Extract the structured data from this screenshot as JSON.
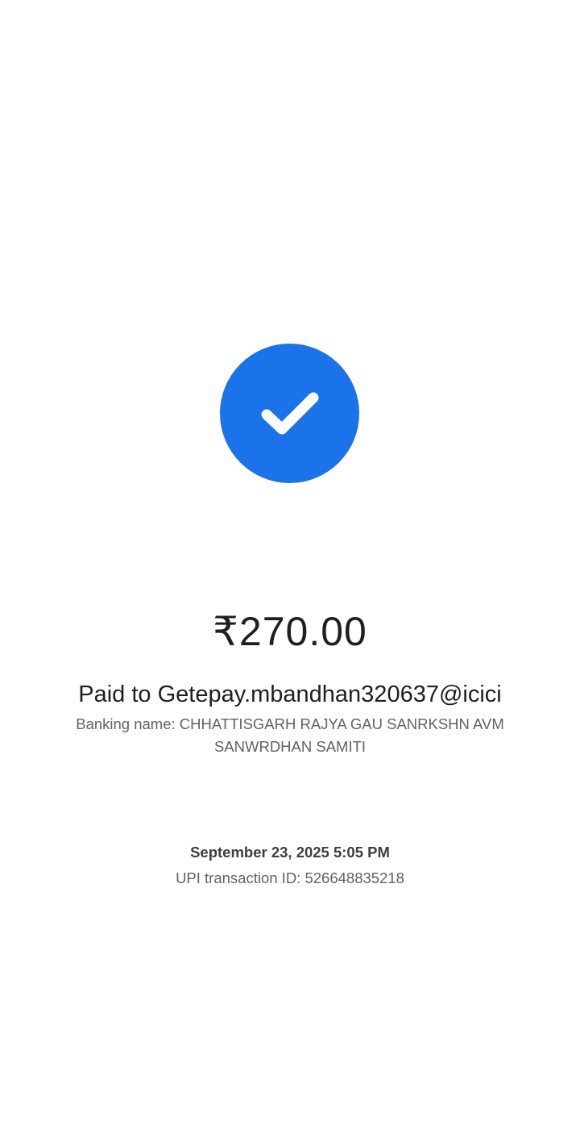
{
  "colors": {
    "accent": "#1a73e8",
    "check": "#ffffff",
    "primary_text": "#1f1f1f",
    "secondary_text": "#5f6368"
  },
  "status": {
    "icon": "check-circle-icon"
  },
  "payment": {
    "amount": "₹270.00",
    "paid_to": "Paid to Getepay.mbandhan320637@icici",
    "banking_name": "Banking name: CHHATTISGARH RAJYA GAU SANRKSHN AVM SANWRDHAN SAMITI",
    "datetime": "September 23, 2025 5:05 PM",
    "transaction_id": "UPI transaction ID: 526648835218"
  }
}
